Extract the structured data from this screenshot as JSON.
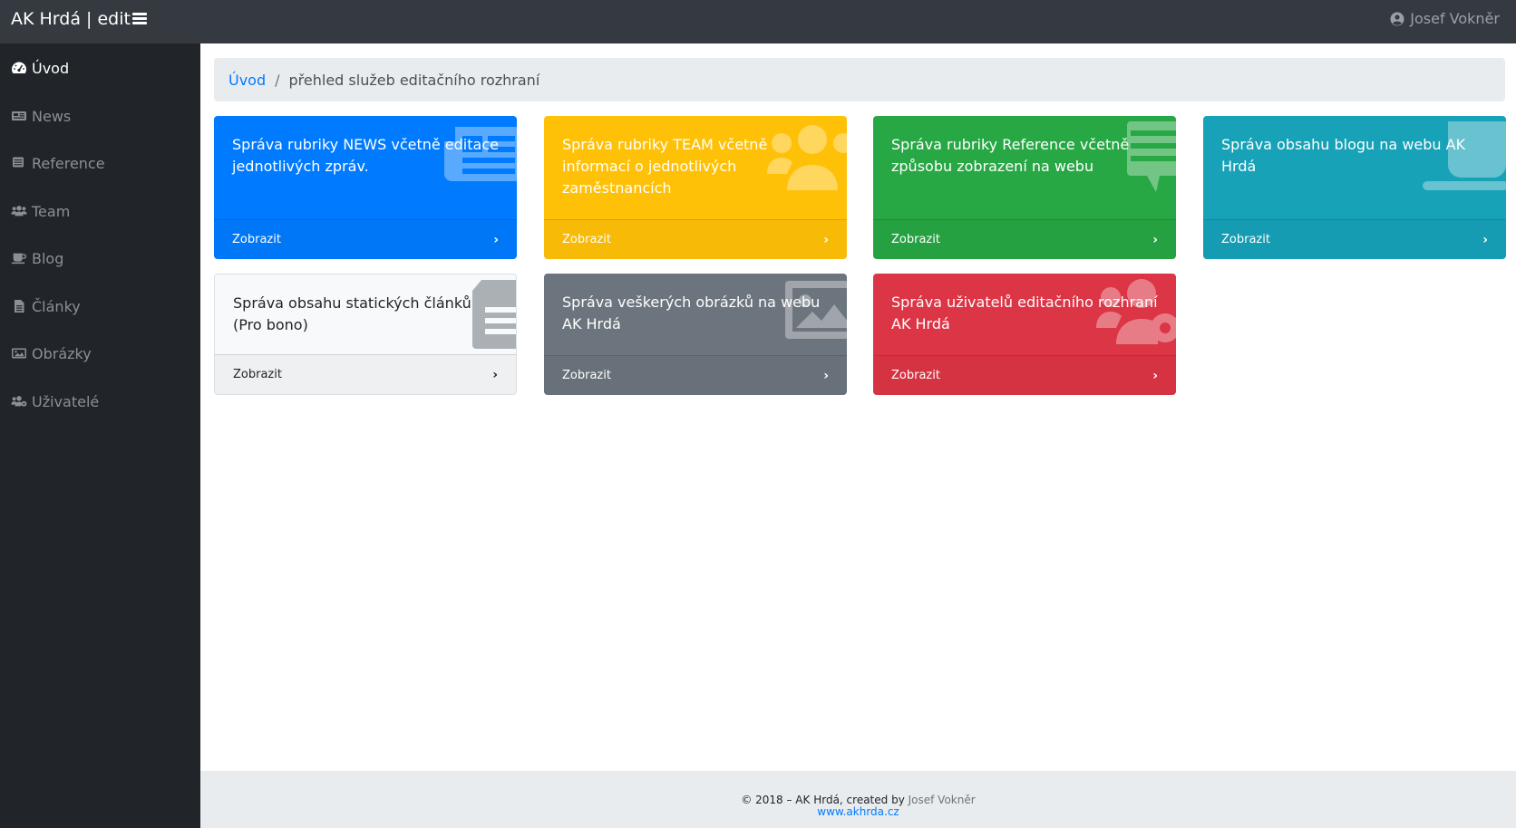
{
  "header": {
    "brand": "AK Hrdá | edit",
    "user_name": "Josef Vokněr"
  },
  "sidebar": {
    "items": [
      {
        "label": "Úvod",
        "icon": "tachometer-icon",
        "active": true
      },
      {
        "label": "News",
        "icon": "newspaper-icon"
      },
      {
        "label": "Reference",
        "icon": "comment-icon"
      },
      {
        "label": "Team",
        "icon": "users-icon"
      },
      {
        "label": "Blog",
        "icon": "coffee-icon"
      },
      {
        "label": "Články",
        "icon": "file-icon"
      },
      {
        "label": "Obrázky",
        "icon": "image-icon"
      },
      {
        "label": "Uživatelé",
        "icon": "users-cog-icon"
      }
    ]
  },
  "breadcrumb": {
    "home": "Úvod",
    "separator": "/",
    "current": "přehled služeb editačního rozhraní"
  },
  "cards": [
    {
      "text": "Správa rubriky NEWS včetně editace jednotlivých zpráv.",
      "link": "Zobrazit",
      "color": "#007bff",
      "icon": "newspaper-icon"
    },
    {
      "text": "Správa rubriky TEAM včetně informací o jednotlivých zaměstnancích",
      "link": "Zobrazit",
      "color": "#ffc107",
      "icon": "users-icon"
    },
    {
      "text": "Správa rubriky Reference včetně způsobu zobrazení na webu",
      "link": "Zobrazit",
      "color": "#28a745",
      "icon": "comment-icon"
    },
    {
      "text": "Správa obsahu blogu na webu AK Hrdá",
      "link": "Zobrazit",
      "color": "#17a2b8",
      "icon": "coffee-icon"
    },
    {
      "text": "Správa obsahu statických článků (Pro bono)",
      "link": "Zobrazit",
      "color": "#f8f9fa",
      "icon": "file-icon"
    },
    {
      "text": "Správa veškerých obrázků na webu AK Hrdá",
      "link": "Zobrazit",
      "color": "#6c757d",
      "icon": "image-icon"
    },
    {
      "text": "Správa uživatelů editačního rozhraní AK Hrdá",
      "link": "Zobrazit",
      "color": "#dc3545",
      "icon": "users-cog-icon"
    }
  ],
  "footer": {
    "copyright": "© 2018 – AK Hrdá, created by",
    "author": "Josef Vokněr",
    "url": "www.akhrda.cz"
  }
}
